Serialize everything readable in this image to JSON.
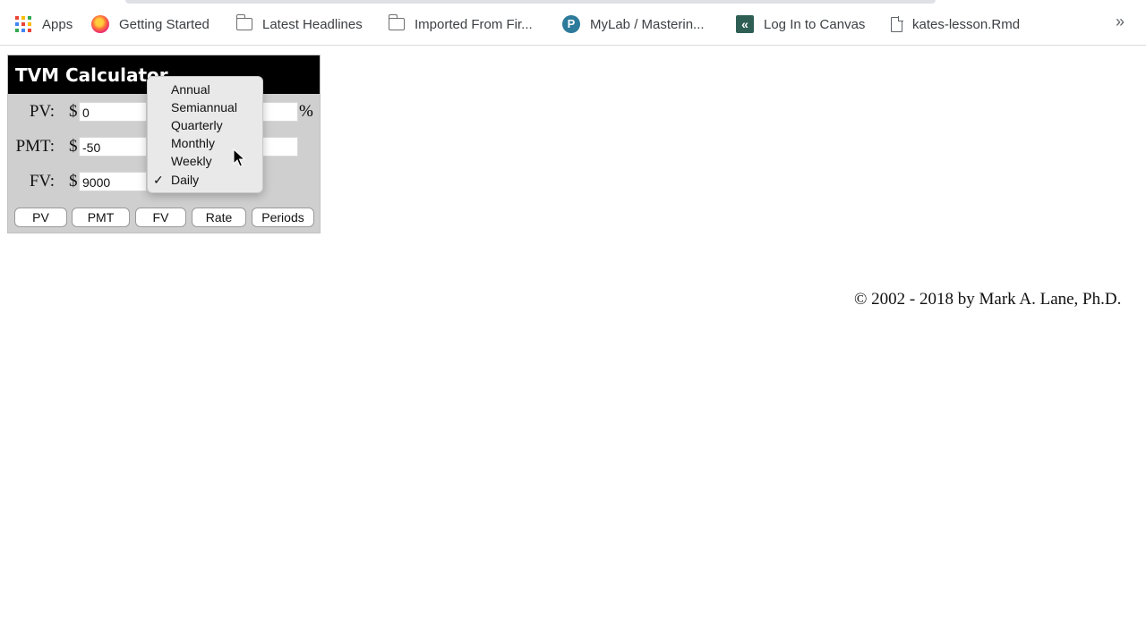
{
  "bookmarks": {
    "items": [
      {
        "label": "Apps",
        "icon": "apps-grid-icon"
      },
      {
        "label": "Getting Started",
        "icon": "firefox-icon"
      },
      {
        "label": "Latest Headlines",
        "icon": "folder-icon"
      },
      {
        "label": "Imported From Fir...",
        "icon": "folder-icon"
      },
      {
        "label": "MyLab / Masterin...",
        "icon": "pearson-icon"
      },
      {
        "label": "Log In to Canvas",
        "icon": "canvas-icon"
      },
      {
        "label": "kates-lesson.Rmd",
        "icon": "document-icon"
      }
    ],
    "overflow": "»"
  },
  "calculator": {
    "title": "TVM Calculator",
    "currency": "$",
    "percent": "%",
    "fields": [
      {
        "label": "PV:",
        "value": "0"
      },
      {
        "label": "PMT:",
        "value": "-50"
      },
      {
        "label": "FV:",
        "value": "9000"
      }
    ],
    "buttons": [
      "PV",
      "PMT",
      "FV",
      "Rate",
      "Periods"
    ]
  },
  "compounding_menu": {
    "options": [
      "Annual",
      "Semiannual",
      "Quarterly",
      "Monthly",
      "Weekly",
      "Daily"
    ],
    "selected": "Daily",
    "check": "✓"
  },
  "footer": {
    "copyright": "© 2002 - 2018 by Mark A. Lane, Ph.D."
  },
  "colors": {
    "title_bar": "#000000",
    "calc_bg": "#cfcfcf",
    "menu_bg": "#e9e9e9"
  }
}
